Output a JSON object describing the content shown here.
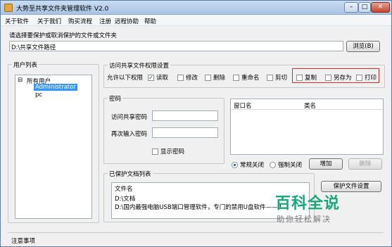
{
  "window": {
    "title": "大势至共享文件夹管理软件 V2.0",
    "controls": {
      "minimize": "–",
      "maximize": "□",
      "close": "✕"
    }
  },
  "menu": [
    "关于软件",
    "关于我们",
    "购买流程",
    "注册",
    "远程协助",
    "帮助"
  ],
  "folder": {
    "prompt": "请选择要保护或取消保护的文件或文件夹",
    "path_value": "D:\\共享文件路径",
    "browse_label": "浏览(B)"
  },
  "users": {
    "group_title": "用户列表",
    "root": "所有用户",
    "items": [
      "Administrator",
      "pc"
    ]
  },
  "permissions": {
    "group_title": "访问共享文件权限设置",
    "allow_label": "允许以下权限",
    "items": [
      {
        "label": "读取",
        "checked": true
      },
      {
        "label": "修改",
        "checked": false
      },
      {
        "label": "删除",
        "checked": false
      },
      {
        "label": "重命名",
        "checked": false
      },
      {
        "label": "剪切",
        "checked": false
      },
      {
        "label": "复制",
        "checked": false
      },
      {
        "label": "另存为",
        "checked": false
      },
      {
        "label": "打印",
        "checked": false
      }
    ]
  },
  "password": {
    "group_title": "密码",
    "access_label": "访问共享密码",
    "confirm_label": "再次输入密码",
    "show_label": "显示密码"
  },
  "windows_list": {
    "col_window": "窗口名",
    "col_class": "类名"
  },
  "close_mode": {
    "normal": "常规关闭",
    "force": "强制关闭",
    "add": "增加",
    "delete": "删除"
  },
  "protected": {
    "group_title": "已保护文档列表",
    "header": "文件名",
    "rows": [
      "D:\\文档",
      "D:\\国内最强电脑USB端口管理软件，专门的禁用U盘软件——大势至U"
    ],
    "side_button": "保护文件设置"
  },
  "notes": {
    "title": "注意事项"
  },
  "watermark": {
    "big": "百科全说",
    "small": "助你轻松解决"
  },
  "colors": {
    "highlight_border": "#e0262c",
    "selection": "#3399ff",
    "watermark": "#1aa87a"
  }
}
